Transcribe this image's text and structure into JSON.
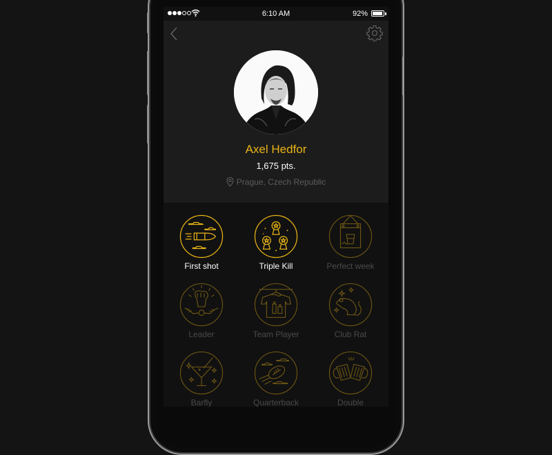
{
  "status_bar": {
    "signal_bars_filled": 3,
    "signal_bars_total": 5,
    "time": "6:10 AM",
    "battery_percent": "92%",
    "battery_level": 0.92
  },
  "nav": {
    "back_icon": "chevron-left-icon",
    "settings_icon": "gear-icon"
  },
  "profile": {
    "name": "Axel Hedfor",
    "points": "1,675 pts.",
    "location": "Prague, Czech Republic",
    "location_icon": "map-pin-icon"
  },
  "colors": {
    "accent": "#e9b415",
    "accent_dim": "#6a5414",
    "background": "#111111",
    "header_background": "#1c1c1c",
    "label_locked": "#4a4a4a"
  },
  "badges": [
    {
      "label": "First shot",
      "icon": "bullet-icon",
      "unlocked": true
    },
    {
      "label": "Triple Kill",
      "icon": "medals-icon",
      "unlocked": true
    },
    {
      "label": "Perfect week",
      "icon": "calendar-cup-icon",
      "unlocked": false
    },
    {
      "label": "Leader",
      "icon": "fist-laurel-icon",
      "unlocked": false
    },
    {
      "label": "Team Player",
      "icon": "tshirt-bottles-icon",
      "unlocked": false
    },
    {
      "label": "Club Rat",
      "icon": "rat-icon",
      "unlocked": false
    },
    {
      "label": "Barfly",
      "icon": "martini-icon",
      "unlocked": false
    },
    {
      "label": "Quarterback",
      "icon": "football-icon",
      "unlocked": false
    },
    {
      "label": "Double",
      "icon": "beer-mugs-icon",
      "unlocked": false
    }
  ]
}
